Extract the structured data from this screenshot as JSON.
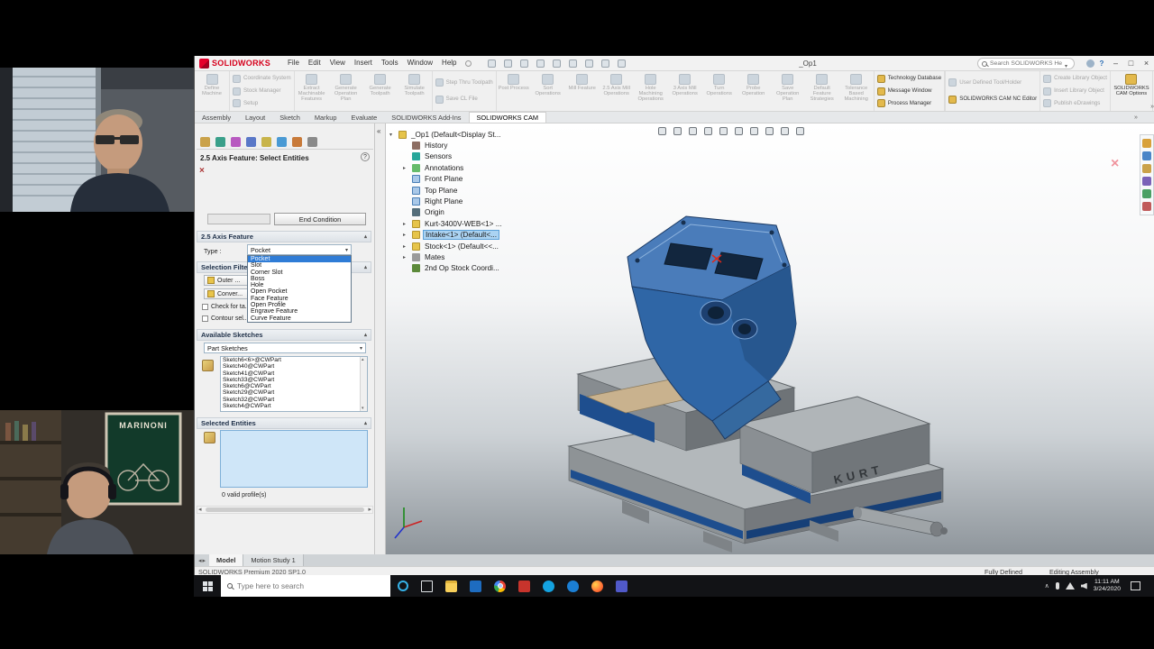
{
  "icons": {
    "close": "×",
    "minimize": "–",
    "maximize": "□",
    "help": "?",
    "question": "?",
    "panel_close": "×",
    "pink_close": "×",
    "collapse_left": "«",
    "overflow": "»",
    "scroll_left": "◂",
    "scroll_right": "▸",
    "tray_chevron": "∧"
  },
  "webcams": {
    "poster_text": "MARINONI"
  },
  "titlebar": {
    "brand": "SOLIDWORKS",
    "menus": [
      "File",
      "Edit",
      "View",
      "Insert",
      "Tools",
      "Window",
      "Help"
    ],
    "doc_title": "_Op1",
    "search_placeholder": "Search SOLIDWORKS Help",
    "quick_icons": [
      {
        "name": "home-icon"
      },
      {
        "name": "open-icon"
      },
      {
        "name": "save-icon"
      },
      {
        "name": "print-icon"
      },
      {
        "name": "undo-icon"
      },
      {
        "name": "redo-icon"
      },
      {
        "name": "select-icon"
      },
      {
        "name": "rebuild-icon"
      },
      {
        "name": "options-icon"
      }
    ]
  },
  "ribbon": {
    "large_left": [
      {
        "label": "Define Machine",
        "state": "off"
      }
    ],
    "stack1": [
      {
        "label": "Coordinate System",
        "state": "off"
      },
      {
        "label": "Stock Manager",
        "state": "off"
      },
      {
        "label": "Setup",
        "state": "off"
      }
    ],
    "large_mid": [
      {
        "label": "Extract Machinable Features",
        "state": "off"
      },
      {
        "label": "Generate Operation Plan",
        "state": "off"
      },
      {
        "label": "Generate Toolpath",
        "state": "off"
      },
      {
        "label": "Simulate Toolpath",
        "state": "off"
      }
    ],
    "stack2": [
      {
        "label": "Step Thru Toolpath",
        "state": "off"
      },
      {
        "label": "Save CL File",
        "state": "off"
      }
    ],
    "large_right": [
      {
        "label": "Post Process",
        "state": "off"
      },
      {
        "label": "Sort Operations",
        "state": "off"
      },
      {
        "label": "Mill Feature",
        "state": "off"
      },
      {
        "label": "2.5 Axis Mill Operations",
        "state": "off"
      },
      {
        "label": "Hole Machining Operations",
        "state": "off"
      },
      {
        "label": "3 Axis Mill Operations",
        "state": "off"
      },
      {
        "label": "Turn Operations",
        "state": "off"
      },
      {
        "label": "Probe Operation",
        "state": "off"
      },
      {
        "label": "Save Operation Plan",
        "state": "off"
      },
      {
        "label": "Default Feature Strategies",
        "state": "off"
      },
      {
        "label": "Tolerance Based Machining",
        "state": "off"
      }
    ],
    "stack3": [
      {
        "label": "Technology Database",
        "state": "on"
      },
      {
        "label": "Message Window",
        "state": "on"
      },
      {
        "label": "Process Manager",
        "state": "on"
      }
    ],
    "stack4": [
      {
        "label": "User Defined Tool/Holder",
        "state": "off"
      },
      {
        "label": "SOLIDWORKS CAM NC Editor",
        "state": "on"
      }
    ],
    "stack5": [
      {
        "label": "Create Library Object",
        "state": "off"
      },
      {
        "label": "Insert Library Object",
        "state": "off"
      },
      {
        "label": "Publish eDrawings",
        "state": "off"
      }
    ],
    "large_end": [
      {
        "label": "SOLIDWORKS CAM Options",
        "state": "on"
      }
    ]
  },
  "tabs": [
    {
      "label": "Assembly",
      "state": ""
    },
    {
      "label": "Layout",
      "state": ""
    },
    {
      "label": "Sketch",
      "state": ""
    },
    {
      "label": "Markup",
      "state": ""
    },
    {
      "label": "Evaluate",
      "state": ""
    },
    {
      "label": "SOLIDWORKS Add-Ins",
      "state": ""
    },
    {
      "label": "SOLIDWORKS CAM",
      "state": "active"
    }
  ],
  "panel": {
    "title": "2.5 Axis Feature: Select Entities",
    "end_condition_tab": "End Condition",
    "group_feature": "2.5 Axis Feature",
    "type_label": "Type :",
    "type_value": "Pocket",
    "type_options": [
      {
        "label": "Pocket",
        "state": "sel"
      },
      {
        "label": "Slot",
        "state": ""
      },
      {
        "label": "Corner Slot",
        "state": ""
      },
      {
        "label": "Boss",
        "state": ""
      },
      {
        "label": "Hole",
        "state": ""
      },
      {
        "label": "Open Pocket",
        "state": ""
      },
      {
        "label": "Face Feature",
        "state": ""
      },
      {
        "label": "Open Profile",
        "state": ""
      },
      {
        "label": "Engrave Feature",
        "state": ""
      },
      {
        "label": "Curve Feature",
        "state": ""
      }
    ],
    "group_filter": "Selection Filter",
    "filter_buttons": [
      {
        "label": "Outer ..."
      },
      {
        "label": "Conver..."
      }
    ],
    "filter_checks": [
      {
        "label": "Check for ta..."
      },
      {
        "label": "Contour sel..."
      }
    ],
    "group_sketches": "Available Sketches",
    "sketch_filter_value": "Part Sketches",
    "sketches": [
      "Sketch6<6>@CWPart",
      "Sketch40@CWPart",
      "Sketch41@CWPart",
      "Sketch33@CWPart",
      "Sketch6@CWPart",
      "Sketch29@CWPart",
      "Sketch32@CWPart",
      "Sketch4@CWPart"
    ],
    "group_selected": "Selected Entities",
    "valid_profiles": "0 valid profile(s)",
    "panel_tabs": [
      {
        "name": "featuremanager-tab-icon",
        "cls": "pt1"
      },
      {
        "name": "propertymanager-tab-icon",
        "cls": "pt2"
      },
      {
        "name": "configurationmanager-tab-icon",
        "cls": "pt3"
      },
      {
        "name": "dimxpert-tab-icon",
        "cls": "pt4"
      },
      {
        "name": "display-manager-tab-icon",
        "cls": "pt5"
      },
      {
        "name": "cam-feature-tree-tab-icon",
        "cls": "pt6"
      },
      {
        "name": "cam-operation-tree-tab-icon",
        "cls": "pt7"
      },
      {
        "name": "cam-tools-tree-tab-icon",
        "cls": "pt8"
      }
    ]
  },
  "tree": {
    "root": "_Op1 (Default<Display St...",
    "items": [
      {
        "label": "History",
        "icon": "history-icon",
        "cls": "ic-history",
        "state": "",
        "arrowcls": ""
      },
      {
        "label": "Sensors",
        "icon": "sensors-icon",
        "cls": "ic-sensors",
        "state": "",
        "arrowcls": ""
      },
      {
        "label": "Annotations",
        "icon": "annotations-icon",
        "cls": "ic-annotations",
        "state": "",
        "arrowcls": "has"
      },
      {
        "label": "Front Plane",
        "icon": "plane-icon",
        "cls": "ic-plane",
        "state": "",
        "arrowcls": ""
      },
      {
        "label": "Top Plane",
        "icon": "plane-icon",
        "cls": "ic-plane",
        "state": "",
        "arrowcls": ""
      },
      {
        "label": "Right Plane",
        "icon": "plane-icon",
        "cls": "ic-plane",
        "state": "",
        "arrowcls": ""
      },
      {
        "label": "Origin",
        "icon": "origin-icon",
        "cls": "ic-origin",
        "state": "",
        "arrowcls": ""
      },
      {
        "label": "Kurt-3400V-WEB<1> ...",
        "icon": "part-icon",
        "cls": "ic-part",
        "state": "",
        "arrowcls": "has"
      },
      {
        "label": "Intake<1> (Default<...",
        "icon": "part-icon",
        "cls": "ic-part",
        "state": "sel",
        "arrowcls": "has"
      },
      {
        "label": "Stock<1> (Default<<...",
        "icon": "part-icon",
        "cls": "ic-part",
        "state": "",
        "arrowcls": "has"
      },
      {
        "label": "Mates",
        "icon": "mates-icon",
        "cls": "ic-mates",
        "state": "",
        "arrowcls": "has"
      },
      {
        "label": "2nd Op Stock Coordi...",
        "icon": "coordinate-system-icon",
        "cls": "ic-coord",
        "state": "",
        "arrowcls": ""
      }
    ]
  },
  "viewport": {
    "headsup": [
      {
        "name": "zoom-fit-icon"
      },
      {
        "name": "zoom-area-icon"
      },
      {
        "name": "previous-view-icon"
      },
      {
        "name": "section-view-icon"
      },
      {
        "name": "view-orientation-icon"
      },
      {
        "name": "display-style-icon"
      },
      {
        "name": "hide-show-items-icon"
      },
      {
        "name": "edit-appearance-icon"
      },
      {
        "name": "apply-scene-icon"
      },
      {
        "name": "view-settings-icon"
      }
    ],
    "taskpane": [
      {
        "name": "task-pane-home-icon",
        "cls": "tp-home"
      },
      {
        "name": "design-library-icon",
        "cls": "tp-lib"
      },
      {
        "name": "file-explorer-pane-icon",
        "cls": "tp-file"
      },
      {
        "name": "view-palette-icon",
        "cls": "tp-pal"
      },
      {
        "name": "appearances-icon",
        "cls": "tp-app"
      },
      {
        "name": "custom-properties-icon",
        "cls": "tp-prop"
      }
    ],
    "vise_brand": "KURT"
  },
  "bottom_tabs": [
    {
      "label": "Model",
      "state": "active"
    },
    {
      "label": "Motion Study 1",
      "state": ""
    }
  ],
  "statusbar": {
    "left": "SOLIDWORKS Premium 2020 SP1.0",
    "defined": "Fully Defined",
    "mode": "Editing Assembly"
  },
  "taskbar": {
    "search_placeholder": "Type here to search",
    "icons": [
      {
        "name": "cortana-icon",
        "cls": "tb-cortana",
        "state": ""
      },
      {
        "name": "task-view-icon",
        "cls": "tb-taskview",
        "state": ""
      },
      {
        "name": "file-explorer-icon",
        "cls": "tb-explorer",
        "state": ""
      },
      {
        "name": "outlook-icon",
        "cls": "tb-outlook",
        "state": ""
      },
      {
        "name": "chrome-icon",
        "cls": "tb-chrome",
        "state": ""
      },
      {
        "name": "solidworks-icon",
        "cls": "tb-sw",
        "state": "active"
      },
      {
        "name": "skype-icon",
        "cls": "tb-skype",
        "state": ""
      },
      {
        "name": "edge-icon",
        "cls": "tb-edge",
        "state": ""
      },
      {
        "name": "firefox-icon",
        "cls": "tb-firefox",
        "state": ""
      },
      {
        "name": "teams-icon",
        "cls": "tb-teams",
        "state": ""
      }
    ],
    "time": "11:11 AM",
    "date": "3/24/2020"
  }
}
